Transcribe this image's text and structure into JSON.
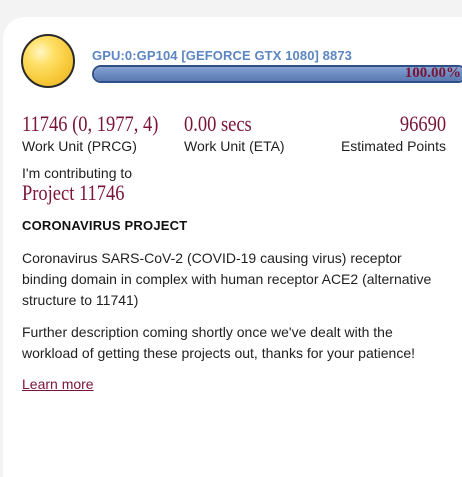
{
  "slot": {
    "name": "GPU:0:GP104 [GEFORCE GTX 1080] 8873",
    "progress_text": "100.00%",
    "progress_fraction": 1.0,
    "status_color": "#f7c93a"
  },
  "stats": {
    "work_unit_prcg": {
      "value": "11746 (0, 1977, 4)",
      "label": "Work Unit (PRCG)"
    },
    "eta": {
      "value": "0.00 secs",
      "label": "Work Unit (ETA)"
    },
    "points": {
      "value": "96690",
      "label": "Estimated Points"
    }
  },
  "project": {
    "contributing_label": "I'm contributing to",
    "title": "Project 11746",
    "heading": "CORONAVIRUS PROJECT",
    "description_1": "Coronavirus SARS-CoV-2 (COVID-19 causing virus) receptor binding domain in complex with human receptor ACE2 (alternative structure to 11741)",
    "description_2": "Further description coming shortly once we've dealt with the workload of getting these projects out, thanks for your patience!",
    "learn_more": "Learn more"
  },
  "colors": {
    "accent_text": "#7a1436",
    "progress_border": "#2f4f87",
    "progress_fill": "#6a89c0",
    "slot_name": "#5b86c2"
  }
}
